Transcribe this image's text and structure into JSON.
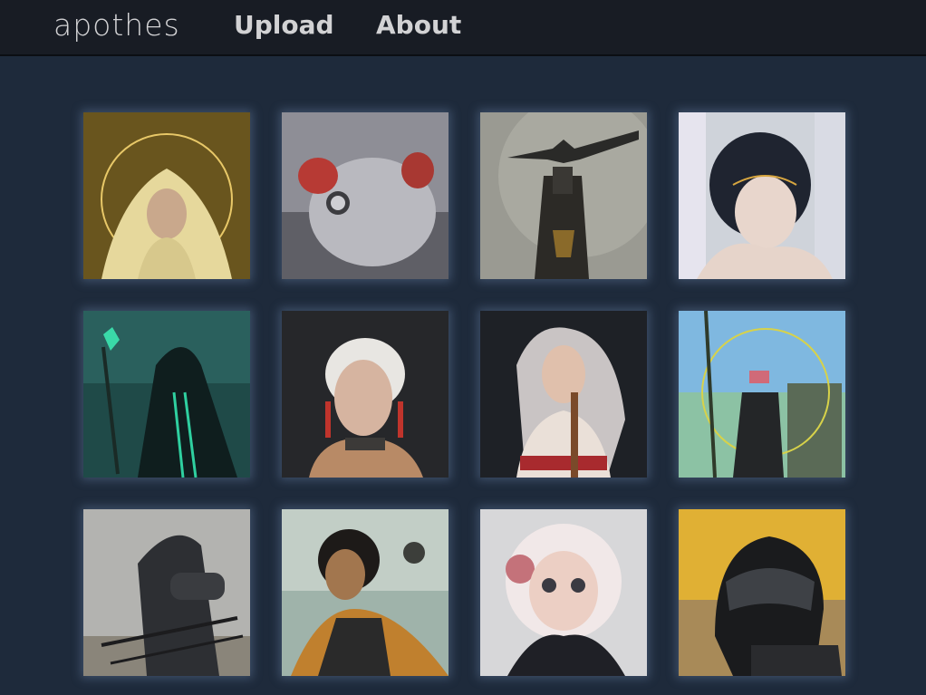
{
  "nav": {
    "brand": "apothes",
    "links": [
      "Upload",
      "About"
    ]
  },
  "gallery": {
    "items": [
      "Hooded saint with golden halo",
      "Armored rodent creature",
      "Horned masked knight",
      "Woman with black bob hair and gold chains",
      "Hooded mage with glowing staff",
      "Warrior woman with white hair and feathers",
      "Blonde woman in red corset",
      "Wanderer in ruins",
      "Samurai with swords",
      "Masked woman with cape",
      "Girl with pink hair buns",
      "Masked rider in carbon helmet"
    ]
  },
  "colors": {
    "background": "#1e2a3b",
    "navbar": "#181c24",
    "nav_text": "#d2d2d4"
  }
}
